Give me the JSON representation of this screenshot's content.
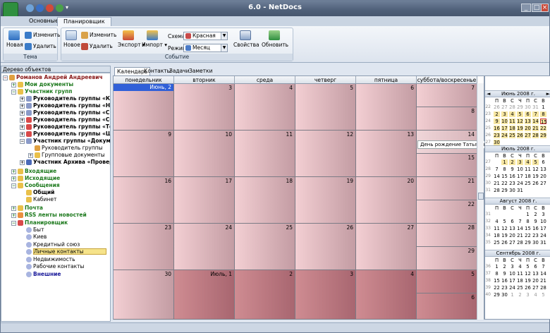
{
  "title": "6.0 - NetDocs",
  "window": {
    "min": "_",
    "max": "□",
    "close": "×"
  },
  "tabs": [
    "Основные",
    "Планировщик"
  ],
  "ribbon": {
    "tema": {
      "new": "Новая",
      "edit": "Изменить",
      "delete": "Удалить",
      "caption": "Тема"
    },
    "event": {
      "new": "Новое",
      "edit": "Изменить",
      "delete": "Удалить",
      "export": "Экспорт",
      "import": "Импорт",
      "scheme_label": "Схема",
      "scheme_value": "Красная",
      "mode_label": "Режим",
      "mode_value": "Месяц",
      "properties": "Свойства",
      "refresh": "Обновить",
      "caption": "Событие"
    }
  },
  "tree": {
    "header": "Дерево объектов",
    "items": [
      {
        "label": "Романов Андрей Андреевич"
      },
      {
        "label": "Мои документы"
      },
      {
        "label": "Участник групп"
      },
      {
        "label": "Руководитель группы «Конт"
      },
      {
        "label": "Руководитель группы «Наук"
      },
      {
        "label": "Руководитель группы «Систе"
      },
      {
        "label": "Руководитель группы «ССП»"
      },
      {
        "label": "Руководитель группы «Тести"
      },
      {
        "label": "Руководитель группы «Шабл"
      },
      {
        "label": "Участник группы «Документ"
      },
      {
        "label": "Руководитель группы"
      },
      {
        "label": "Групповые документы"
      },
      {
        "label": "Участник Архива «Проверочн"
      },
      {
        "label": "Входящие"
      },
      {
        "label": "Исходящие"
      },
      {
        "label": "Сообщения"
      },
      {
        "label": "Общий"
      },
      {
        "label": "Кабинет"
      },
      {
        "label": "Почта"
      },
      {
        "label": "RSS ленты новостей"
      },
      {
        "label": "Планировщик"
      },
      {
        "label": "Быт"
      },
      {
        "label": "Киев"
      },
      {
        "label": "Кредитный союз"
      },
      {
        "label": "Личные контакты"
      },
      {
        "label": "Недвижимость"
      },
      {
        "label": "Рабочие контакты"
      },
      {
        "label": "Внешние"
      }
    ]
  },
  "view_tabs": [
    "Календарь",
    "Контакты",
    "Задачи",
    "Заметки"
  ],
  "weekdays": [
    "понедельник",
    "вторник",
    "среда",
    "четверг",
    "пятница",
    "суббота/воскресенье"
  ],
  "weeks": [
    {
      "days": [
        "Июнь, 2",
        "3",
        "4",
        "5",
        "6"
      ],
      "sat": "7",
      "sun": "8"
    },
    {
      "days": [
        "9",
        "10",
        "11",
        "12",
        "13"
      ],
      "sat": "14",
      "sun": "15"
    },
    {
      "days": [
        "16",
        "17",
        "18",
        "19",
        "20"
      ],
      "sat": "21",
      "sun": "22"
    },
    {
      "days": [
        "23",
        "24",
        "25",
        "26",
        "27"
      ],
      "sat": "28",
      "sun": "29"
    },
    {
      "days": [
        "30",
        "Июль, 1",
        "2",
        "3",
        "4"
      ],
      "sat": "5",
      "sun": "6"
    }
  ],
  "event": "День рождение Татьяны",
  "mini_weekdays": [
    "П",
    "В",
    "С",
    "Ч",
    "П",
    "С",
    "В"
  ],
  "months": [
    {
      "title": "Июнь 2008 г.",
      "weeks": [
        {
          "n": "22",
          "d": [
            "26",
            "27",
            "28",
            "29",
            "30",
            "31",
            "1"
          ]
        },
        {
          "n": "23",
          "d": [
            "2",
            "3",
            "4",
            "5",
            "6",
            "7",
            "8"
          ]
        },
        {
          "n": "24",
          "d": [
            "9",
            "10",
            "11",
            "12",
            "13",
            "14",
            "15"
          ]
        },
        {
          "n": "25",
          "d": [
            "16",
            "17",
            "18",
            "19",
            "20",
            "21",
            "22"
          ]
        },
        {
          "n": "26",
          "d": [
            "23",
            "24",
            "25",
            "26",
            "27",
            "28",
            "29"
          ]
        },
        {
          "n": "27",
          "d": [
            "30",
            "",
            "",
            "",
            "",
            "",
            ""
          ]
        }
      ]
    },
    {
      "title": "Июль 2008 г.",
      "weeks": [
        {
          "n": "27",
          "d": [
            "",
            "1",
            "2",
            "3",
            "4",
            "5",
            "6"
          ]
        },
        {
          "n": "28",
          "d": [
            "7",
            "8",
            "9",
            "10",
            "11",
            "12",
            "13"
          ]
        },
        {
          "n": "29",
          "d": [
            "14",
            "15",
            "16",
            "17",
            "18",
            "19",
            "20"
          ]
        },
        {
          "n": "30",
          "d": [
            "21",
            "22",
            "23",
            "24",
            "25",
            "26",
            "27"
          ]
        },
        {
          "n": "31",
          "d": [
            "28",
            "29",
            "30",
            "31",
            "",
            "",
            ""
          ]
        }
      ]
    },
    {
      "title": "Август 2008 г.",
      "weeks": [
        {
          "n": "31",
          "d": [
            "",
            "",
            "",
            "",
            "1",
            "2",
            "3"
          ]
        },
        {
          "n": "32",
          "d": [
            "4",
            "5",
            "6",
            "7",
            "8",
            "9",
            "10"
          ]
        },
        {
          "n": "33",
          "d": [
            "11",
            "12",
            "13",
            "14",
            "15",
            "16",
            "17"
          ]
        },
        {
          "n": "34",
          "d": [
            "18",
            "19",
            "20",
            "21",
            "22",
            "23",
            "24"
          ]
        },
        {
          "n": "35",
          "d": [
            "25",
            "26",
            "27",
            "28",
            "29",
            "30",
            "31"
          ]
        }
      ]
    },
    {
      "title": "Сентябрь 2008 г.",
      "weeks": [
        {
          "n": "36",
          "d": [
            "1",
            "2",
            "3",
            "4",
            "5",
            "6",
            "7"
          ]
        },
        {
          "n": "37",
          "d": [
            "8",
            "9",
            "10",
            "11",
            "12",
            "13",
            "14"
          ]
        },
        {
          "n": "38",
          "d": [
            "15",
            "16",
            "17",
            "18",
            "19",
            "20",
            "21"
          ]
        },
        {
          "n": "39",
          "d": [
            "22",
            "23",
            "24",
            "25",
            "26",
            "27",
            "28"
          ]
        },
        {
          "n": "40",
          "d": [
            "29",
            "30",
            "1",
            "2",
            "3",
            "4",
            "5"
          ]
        }
      ]
    }
  ]
}
